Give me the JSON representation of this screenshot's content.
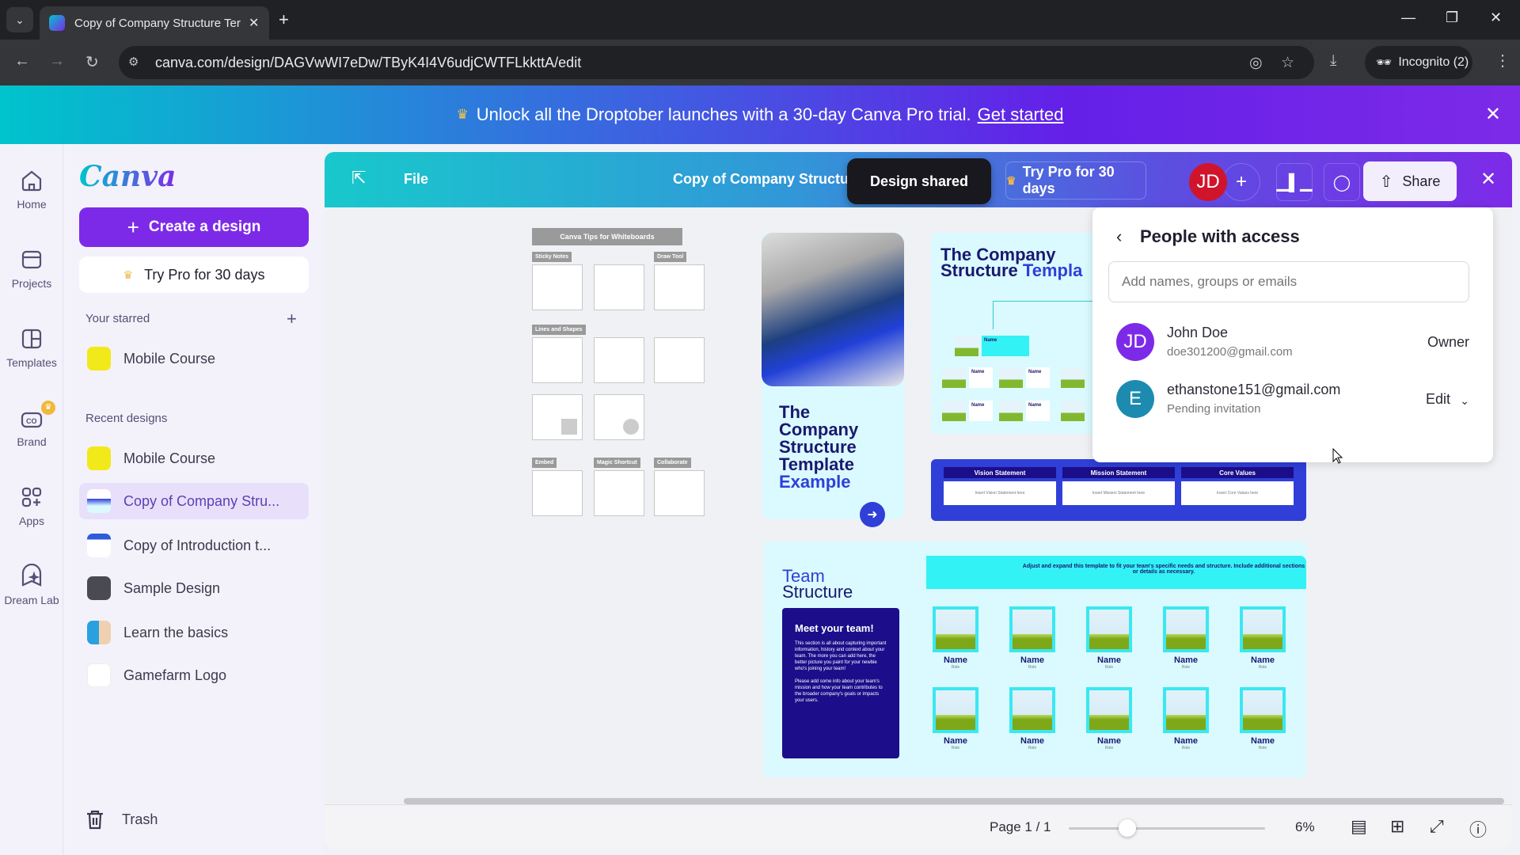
{
  "browser": {
    "tab_title": "Copy of Company Structure Ter",
    "url": "canva.com/design/DAGVwWI7eDw/TByK4I4V6udjCWTFLkkttA/edit",
    "incognito_label": "Incognito (2)"
  },
  "promo": {
    "text": "Unlock all the Droptober launches with a 30-day Canva Pro trial.",
    "link": "Get started"
  },
  "rail": {
    "items": [
      {
        "label": "Home",
        "icon": "home-icon"
      },
      {
        "label": "Projects",
        "icon": "folder-icon"
      },
      {
        "label": "Templates",
        "icon": "templates-icon"
      },
      {
        "label": "Brand",
        "icon": "brand-icon"
      },
      {
        "label": "Apps",
        "icon": "apps-icon"
      },
      {
        "label": "Dream Lab",
        "icon": "dream-lab-icon"
      }
    ]
  },
  "panel": {
    "logo": "Canva",
    "create_label": "Create a design",
    "pro_label": "Try Pro for 30 days",
    "starred_heading": "Your starred",
    "starred": [
      {
        "label": "Mobile Course",
        "color": "#f2e91a"
      }
    ],
    "recent_heading": "Recent designs",
    "recent": [
      {
        "label": "Mobile Course",
        "color": "#f2e91a",
        "active": false
      },
      {
        "label": "Copy of Company Stru...",
        "color": "#dfeaff",
        "active": true
      },
      {
        "label": "Copy of Introduction t...",
        "color": "#e8eaf8",
        "active": false
      },
      {
        "label": "Sample Design",
        "color": "#4a4a52",
        "active": false
      },
      {
        "label": "Learn the basics",
        "color": "#2aa0e0",
        "active": false
      },
      {
        "label": "Gamefarm Logo",
        "color": "#ffffff",
        "active": false
      }
    ],
    "trash_label": "Trash"
  },
  "editor": {
    "file_label": "File",
    "doc_title": "Copy of Company Structure Template",
    "toast": "Design shared",
    "try_pro": "Try Pro for 30 days",
    "avatar_initials": "JD",
    "share_label": "Share"
  },
  "canvas": {
    "tips": {
      "title": "Canva Tips for Whiteboards",
      "sections": [
        "Sticky Notes",
        "Draw Tool",
        "Lines and Shapes",
        "Embed",
        "Magic Shortcut",
        "Collaborate"
      ]
    },
    "hero": {
      "line1": "The",
      "line2": "Company",
      "line3": "Structure",
      "line4": "Template",
      "line5": "Example"
    },
    "org": {
      "title_a": "The Company",
      "title_b": "Structure",
      "title_c": "Templa",
      "card_label": "Name"
    },
    "vmc": [
      {
        "heading": "Vision Statement",
        "body": "Insert Vision Statement here"
      },
      {
        "heading": "Mission Statement",
        "body": "Insert Mission Statement here"
      },
      {
        "heading": "Core Values",
        "body": "Insert Core Values here"
      }
    ],
    "team": {
      "title_a": "Team",
      "title_b": "Structure",
      "banner": "Adjust and expand this template to fit your team's specific needs and structure. Include additional sections or details as necessary.",
      "meet_heading": "Meet your team!",
      "meet_p1": "This section is all about capturing important information, history and context about your team. The more you can add here, the better picture you paint for your newbie who's joining your team!",
      "meet_p2": "Please add some info about your team's mission and how your team contributes to the broader company's goals or impacts your users.",
      "member_name": "Name",
      "member_role": "Role",
      "member_count": 10
    }
  },
  "footer": {
    "page": "Page 1 / 1",
    "zoom_pct": "6%",
    "zoom_fraction": 0.3
  },
  "share_panel": {
    "title": "People with access",
    "input_placeholder": "Add names, groups or emails",
    "people": [
      {
        "initials": "JD",
        "name": "John Doe",
        "sub": "doe301200@gmail.com",
        "role": "Owner",
        "color": "#7d2ae8"
      },
      {
        "initials": "E",
        "name": "ethanstone151@gmail.com",
        "sub": "Pending invitation",
        "role": "Edit",
        "color": "#1d8bb0"
      }
    ]
  }
}
